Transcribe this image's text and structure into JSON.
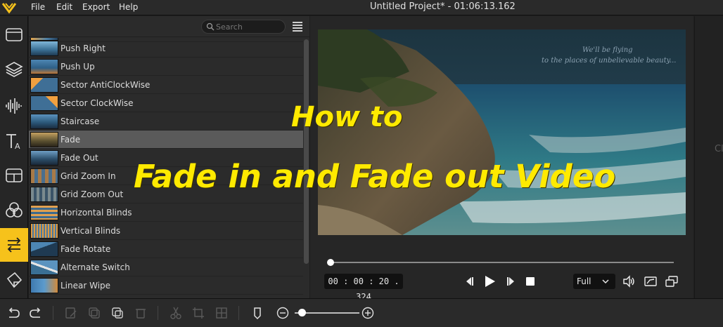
{
  "menubar": {
    "items": [
      "File",
      "Edit",
      "Export",
      "Help"
    ],
    "title": "Untitled Project* - 01:06:13.162",
    "logo_icon": "app-logo-icon",
    "accent_color": "#f6c21b"
  },
  "toolbar": {
    "tools": [
      {
        "name": "media",
        "icon": "folder-icon"
      },
      {
        "name": "layers",
        "icon": "layers-icon"
      },
      {
        "name": "audio",
        "icon": "audio-waveform-icon"
      },
      {
        "name": "text",
        "icon": "text-icon"
      },
      {
        "name": "overlays",
        "icon": "overlay-icon"
      },
      {
        "name": "filters",
        "icon": "filters-icon"
      },
      {
        "name": "transitions",
        "icon": "transitions-icon",
        "active": true
      },
      {
        "name": "elements",
        "icon": "sticker-icon"
      }
    ]
  },
  "panel": {
    "search_placeholder": "Search",
    "items": [
      {
        "label": "",
        "partial": true
      },
      {
        "label": "Push Right"
      },
      {
        "label": "Push Up"
      },
      {
        "label": "Sector AntiClockWise"
      },
      {
        "label": "Sector ClockWise"
      },
      {
        "label": "Staircase"
      },
      {
        "label": "Fade",
        "selected": true
      },
      {
        "label": "Fade Out"
      },
      {
        "label": "Grid Zoom In"
      },
      {
        "label": "Grid Zoom Out"
      },
      {
        "label": "Horizontal Blinds"
      },
      {
        "label": "Vertical Blinds"
      },
      {
        "label": "Fade Rotate"
      },
      {
        "label": "Alternate Switch"
      },
      {
        "label": "Linear Wipe"
      }
    ]
  },
  "preview": {
    "caption_line1": "We'll be flying",
    "caption_line2": "to the places of unbelievable beauty...",
    "timecode": "00 : 00 : 20 . 324",
    "progress": 0.0,
    "quality": "Full",
    "right_strip_text": "Cl"
  },
  "overlay": {
    "line1": "How to",
    "line2": "Fade in and Fade out Video",
    "color": "#ffea00"
  },
  "timeline": {
    "zoom_level": 0.1
  }
}
